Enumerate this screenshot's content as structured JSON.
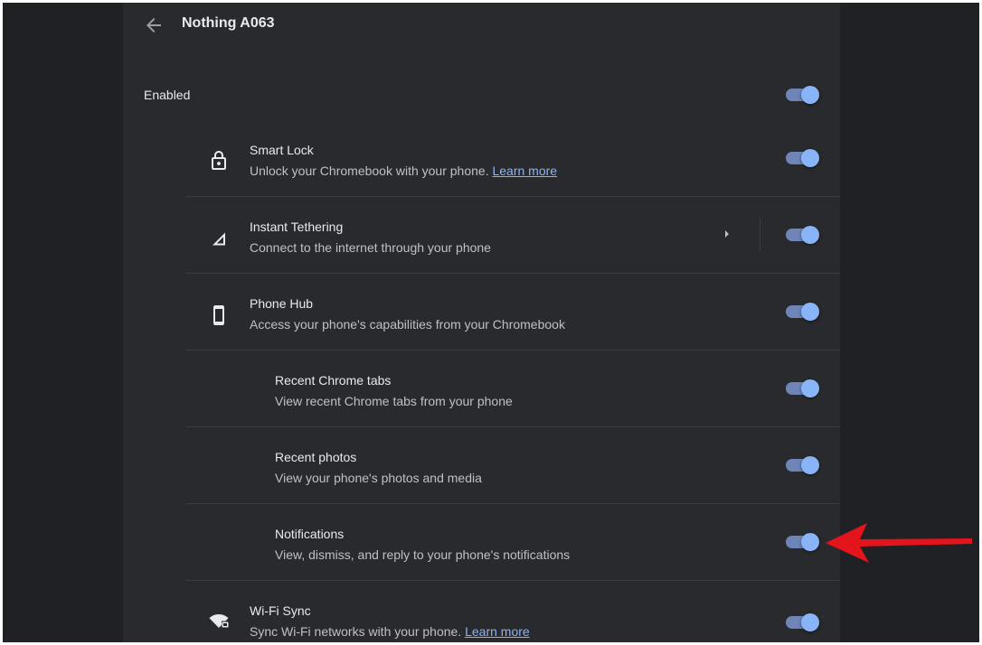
{
  "header": {
    "title": "Nothing A063"
  },
  "enabled": {
    "label": "Enabled",
    "on": true
  },
  "features": [
    {
      "id": "smart-lock",
      "icon": "lock-icon",
      "name": "Smart Lock",
      "description": "Unlock your Chromebook with your phone. ",
      "link": "Learn more",
      "on": true
    },
    {
      "id": "instant-tethering",
      "icon": "signal-icon",
      "name": "Instant Tethering",
      "description": "Connect to the internet through your phone",
      "has_submenu": true,
      "on": true
    },
    {
      "id": "phone-hub",
      "icon": "phone-icon",
      "name": "Phone Hub",
      "description": "Access your phone's capabilities from your Chromebook",
      "on": true
    },
    {
      "id": "recent-chrome-tabs",
      "name": "Recent Chrome tabs",
      "description": "View recent Chrome tabs from your phone",
      "on": true
    },
    {
      "id": "recent-photos",
      "name": "Recent photos",
      "description": "View your phone's photos and media",
      "on": true
    },
    {
      "id": "notifications",
      "name": "Notifications",
      "description": "View, dismiss, and reply to your phone's notifications",
      "on": true
    },
    {
      "id": "wifi-sync",
      "icon": "wifi-sync-icon",
      "name": "Wi-Fi Sync",
      "description": "Sync Wi-Fi networks with your phone. ",
      "link": "Learn more",
      "on": true
    }
  ],
  "colors": {
    "accent": "#8ab4f8",
    "toggle_track": "#6f85b8",
    "annotation_arrow": "#e3141b"
  }
}
